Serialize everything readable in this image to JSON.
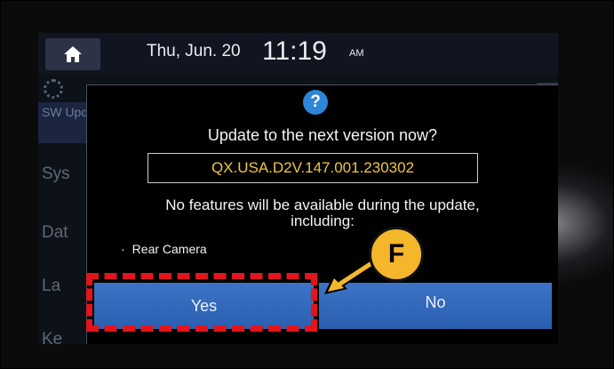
{
  "status_bar": {
    "date": "Thu, Jun. 20",
    "time": "11:19",
    "ampm": "AM"
  },
  "sidebar": {
    "items": [
      {
        "label": "SW Upd"
      },
      {
        "label": "Sys"
      },
      {
        "label": "Dat"
      },
      {
        "label": "La"
      },
      {
        "label": "Ke"
      }
    ]
  },
  "dialog": {
    "icon": "question-icon",
    "icon_text": "?",
    "title": "Update to the next version now?",
    "version": "QX.USA.D2V.147.001.230302",
    "warning_line1": "No features will be available during the update,",
    "warning_line2": "including:",
    "bullet_marker": "·",
    "bullet_item": "Rear Camera",
    "yes_label": "Yes",
    "no_label": "No"
  },
  "annotation": {
    "callout_letter": "F",
    "highlight_color": "#e3141c",
    "callout_color": "#f4b62b"
  },
  "colors": {
    "accent_button": "#2f66b8",
    "version_text": "#f0c53f",
    "info_icon": "#2d86d8"
  }
}
